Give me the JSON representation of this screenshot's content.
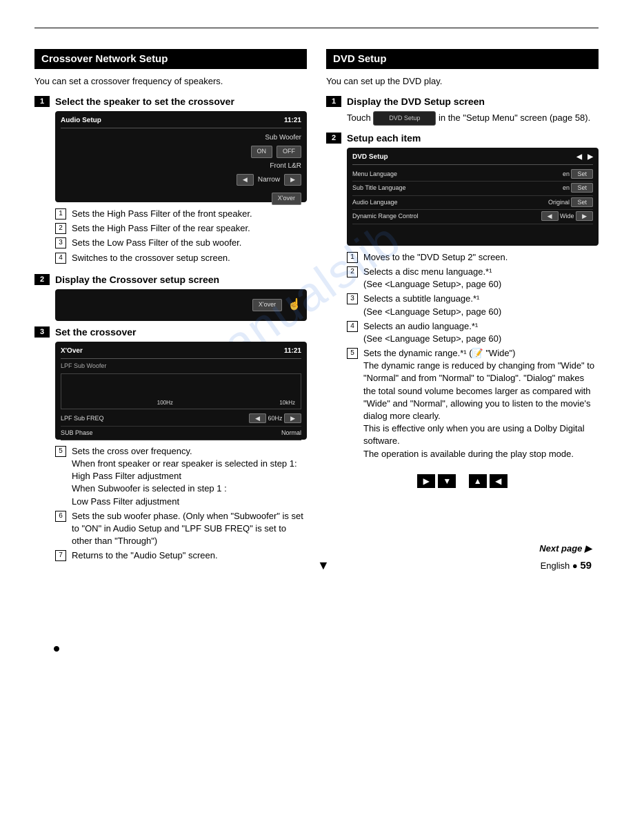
{
  "left": {
    "header": "Crossover Network Setup",
    "intro": "You can set a crossover frequency of speakers.",
    "step1": {
      "num": "1",
      "title": "Select the speaker to set the crossover",
      "ss": {
        "title": "Audio Setup",
        "time": "11:21",
        "sub": "Sub Woofer",
        "on": "ON",
        "off": "OFF",
        "front": "Front L&R",
        "narrow": "Narrow",
        "xover": "X'over"
      },
      "callouts": [
        "Sets the High Pass Filter of the front speaker.",
        "Sets the High Pass Filter of the rear speaker.",
        "Sets the Low Pass Filter of the sub woofer.",
        "Switches to the crossover setup screen."
      ]
    },
    "step2": {
      "num": "2",
      "title": "Display the Crossover setup screen",
      "ss": {
        "xover": "X'over"
      }
    },
    "step3": {
      "num": "3",
      "title": "Set the crossover",
      "ss": {
        "title": "X'Over",
        "time": "11:21",
        "lpf": "LPF Sub Woofer",
        "row1l": "LPF Sub FREQ",
        "row1v": "60Hz",
        "row2l": "SUB Phase",
        "row2v": "Normal",
        "axis1": "100Hz",
        "axis2": "10kHz"
      },
      "callouts": [
        "Sets the cross over frequency.\nWhen front speaker or rear speaker is selected in step 1:\n        High Pass Filter adjustment\nWhen Subwoofer is selected in step 1 :\n        Low Pass Filter adjustment",
        "Sets the sub woofer phase. (Only when \"Subwoofer\" is set to \"ON\" in Audio Setup and \"LPF SUB FREQ\" is set to other than \"Through\")",
        "Returns to the \"Audio Setup\" screen."
      ],
      "callout_nums": [
        "5",
        "6",
        "7"
      ]
    }
  },
  "right": {
    "header": "DVD Setup",
    "intro": "You can set up the DVD play.",
    "step1": {
      "num": "1",
      "title": "Display the DVD Setup screen",
      "touch_pre": "Touch ",
      "touch_btn": "DVD Setup",
      "touch_post": " in the \"Setup Menu\" screen (page 58)."
    },
    "step2": {
      "num": "2",
      "title": "Setup each item",
      "ss": {
        "title": "DVD Setup",
        "rows": [
          {
            "n": "2",
            "label": "Menu Language",
            "val": "en",
            "btn": "Set"
          },
          {
            "n": "3",
            "label": "Sub Title Language",
            "val": "en",
            "btn": "Set"
          },
          {
            "n": "4",
            "label": "Audio Language",
            "val": "Original",
            "btn": "Set"
          },
          {
            "n": "5",
            "label": "Dynamic Range Control",
            "val": "Wide",
            "btn": ""
          }
        ]
      },
      "callouts": [
        "Moves to the \"DVD Setup 2\" screen.",
        "Selects a disc menu language.*¹\n(See <Language Setup>, page 60)",
        "Selects a subtitle language.*¹\n(See <Language Setup>, page 60)",
        "Selects an audio language.*¹\n(See <Language Setup>, page 60)",
        "Sets the dynamic range.*¹ (📝 \"Wide\")\nThe dynamic range is reduced by changing from \"Wide\" to \"Normal\" and from \"Normal\" to \"Dialog\". \"Dialog\" makes the total sound volume becomes larger as compared with \"Wide\" and \"Normal\", allowing you to listen to the movie's dialog more clearly.\nThis is effective only when you are using a Dolby Digital software.\nThe operation is available during the play stop mode."
      ]
    }
  },
  "footer": {
    "next": "Next page ▶",
    "lang": "English",
    "page": "59"
  },
  "watermark": "manualslib"
}
